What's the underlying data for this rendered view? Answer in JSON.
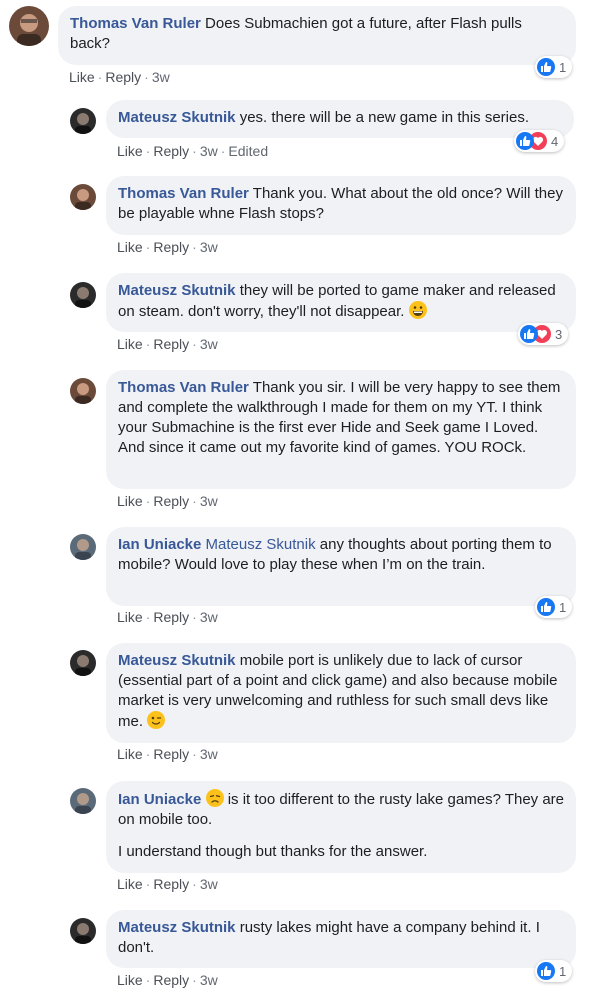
{
  "action_labels": {
    "like": "Like",
    "reply": "Reply",
    "separator": "·"
  },
  "comments": [
    {
      "author": "Thomas Van Ruler",
      "text": "Does Submachien got a future, after Flash pulls back?",
      "time": "3w",
      "reactions": {
        "types": [
          "like"
        ],
        "count": "1"
      }
    },
    {
      "author": "Mateusz Skutnik",
      "text": "yes. there will be a new game in this series.",
      "time": "3w",
      "edited": "Edited",
      "reactions": {
        "types": [
          "like",
          "love"
        ],
        "count": "4"
      }
    },
    {
      "author": "Thomas Van Ruler",
      "text": "Thank you. What about the old once? Will they be playable whne Flash stops?",
      "time": "3w"
    },
    {
      "author": "Mateusz Skutnik",
      "text": "they will be ported to game maker and released on steam. don't worry, they'll not disappear.",
      "emoji": "grinning-face",
      "time": "3w",
      "reactions": {
        "types": [
          "like",
          "love"
        ],
        "count": "3"
      }
    },
    {
      "author": "Thomas Van Ruler",
      "text": "Thank you sir. I will be very happy to see them and complete the walkthrough I made for them on my YT. I think your Submachine is the first ever Hide and Seek game I Loved. And since it came out my favorite kind of games. YOU ROCk.",
      "time": "3w"
    },
    {
      "author": "Ian Uniacke",
      "mention": "Mateusz Skutnik",
      "text": "any thoughts about porting them to mobile? Would love to play these when I’m on the train.",
      "time": "3w",
      "reactions": {
        "types": [
          "like"
        ],
        "count": "1"
      }
    },
    {
      "author": "Mateusz Skutnik",
      "text": "mobile port is unlikely due to lack of cursor (essential part of a point and click game) and also because mobile market is very unwelcoming and ruthless for such small devs like me.",
      "emoji": "winking-face",
      "time": "3w"
    },
    {
      "author": "Ian Uniacke",
      "emoji": "disappointed-face",
      "text": "is it too different to the rusty lake games? They are on mobile too.",
      "text2": "I understand though but thanks for the answer.",
      "time": "3w"
    },
    {
      "author": "Mateusz Skutnik",
      "text": "rusty lakes might have a company behind it. I don't.",
      "time": "3w",
      "reactions": {
        "types": [
          "like"
        ],
        "count": "1"
      }
    }
  ],
  "colors": {
    "author": "#385898",
    "bubble": "#f0f2f5",
    "like": "#1877f2",
    "love": "#f33e58",
    "meta": "#606770"
  }
}
